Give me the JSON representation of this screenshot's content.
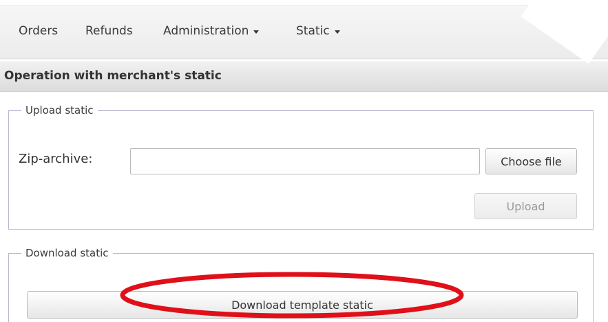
{
  "navbar": {
    "items": [
      {
        "label": "Orders",
        "has_dropdown": false
      },
      {
        "label": "Refunds",
        "has_dropdown": false
      },
      {
        "label": "Administration",
        "has_dropdown": true
      },
      {
        "label": "Static",
        "has_dropdown": true
      }
    ]
  },
  "page": {
    "title": "Operation with merchant's static"
  },
  "upload_section": {
    "legend": "Upload static",
    "zip_label": "Zip-archive:",
    "file_value": "",
    "choose_button": "Choose file",
    "upload_button": "Upload",
    "upload_disabled": true
  },
  "download_section": {
    "legend": "Download static",
    "download_button": "Download template static"
  },
  "annotation": {
    "highlight_color": "#e0101a",
    "highlight_target": "download-template-static-button"
  }
}
